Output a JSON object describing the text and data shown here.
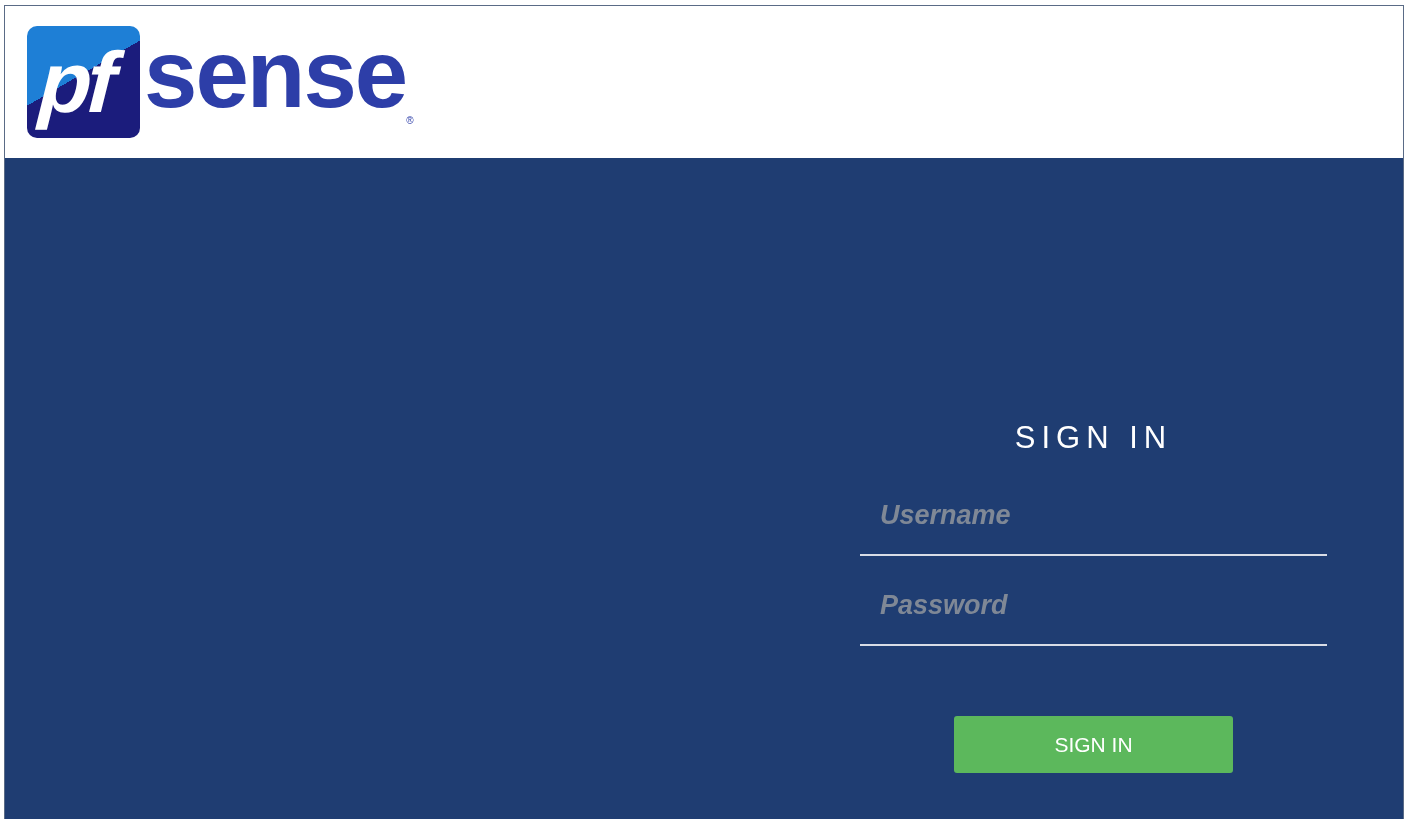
{
  "logo": {
    "mark": "pf",
    "word": "sense",
    "registered": "®"
  },
  "sign_in": {
    "title": "SIGN IN",
    "fields": [
      {
        "placeholder": "Username"
      },
      {
        "placeholder": "Password"
      }
    ],
    "button": "SIGN IN"
  }
}
